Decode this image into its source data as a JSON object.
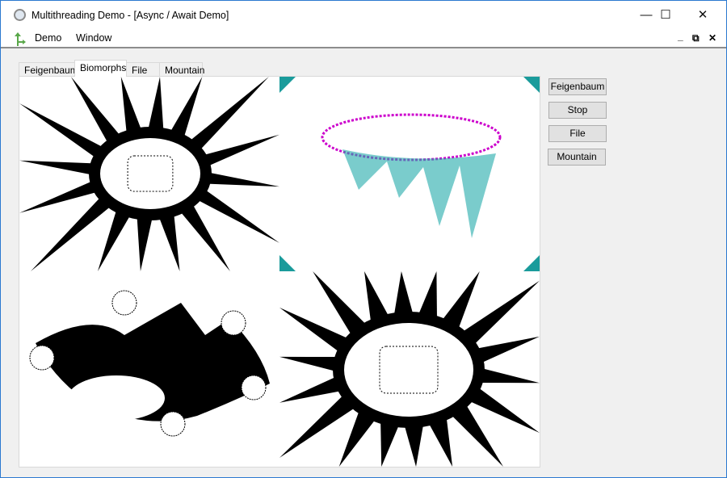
{
  "window": {
    "title": "Multithreading Demo - [Async / Await Demo]",
    "controls": [
      "minimize",
      "maximize",
      "close"
    ]
  },
  "menubar": {
    "items": [
      "Demo",
      "Window"
    ],
    "mdi_controls": [
      "minimize",
      "restore",
      "close"
    ]
  },
  "tabs": {
    "items": [
      "Feigenbaum",
      "Biomorphs",
      "File",
      "Mountain"
    ],
    "active": "Biomorphs"
  },
  "buttons": {
    "feigenbaum": "Feigenbaum",
    "stop": "Stop",
    "file": "File",
    "mountain": "Mountain"
  },
  "colors": {
    "window_border": "#2b79d0",
    "accent_fractal": "#1a9b9b"
  }
}
